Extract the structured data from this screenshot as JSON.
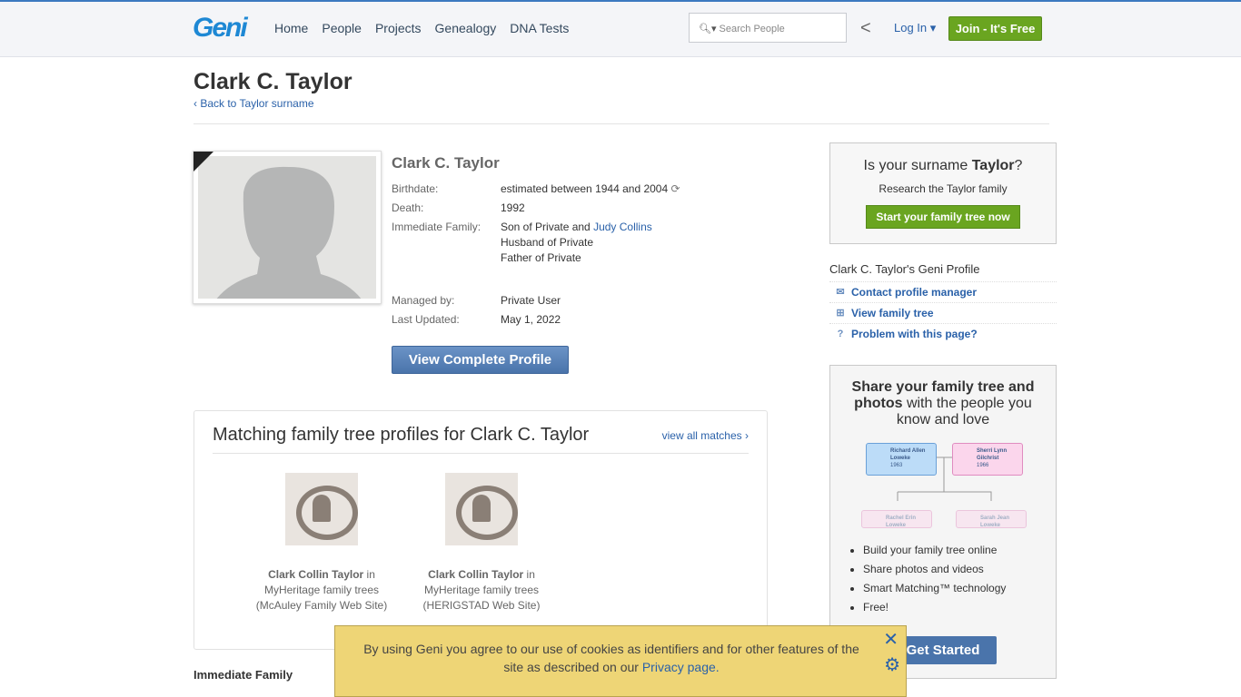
{
  "header": {
    "logo": "Geni",
    "nav": [
      "Home",
      "People",
      "Projects",
      "Genealogy",
      "DNA Tests"
    ],
    "search_placeholder": "Search People",
    "login": "Log In ▾",
    "join": "Join - It's Free"
  },
  "page": {
    "title": "Clark C. Taylor",
    "back": "‹ Back to Taylor surname"
  },
  "profile": {
    "name": "Clark C. Taylor",
    "birthdate_label": "Birthdate:",
    "birthdate": "estimated between 1944 and 2004",
    "death_label": "Death:",
    "death": "1992",
    "family_label": "Immediate Family:",
    "family_son": "Son of Private and ",
    "family_mother": "Judy Collins",
    "family_husband": "Husband of Private",
    "family_father": "Father of Private",
    "managed_label": "Managed by:",
    "managed": "Private User",
    "updated_label": "Last Updated:",
    "updated": "May 1, 2022",
    "view_button": "View Complete Profile"
  },
  "matches": {
    "title": "Matching family tree profiles for Clark C. Taylor",
    "view_all": "view all matches ›",
    "items": [
      {
        "name": "Clark Collin Taylor",
        "in": " in",
        "source": "MyHeritage family trees",
        "site": "(McAuley Family Web Site)"
      },
      {
        "name": "Clark Collin Taylor",
        "in": " in",
        "source": "MyHeritage family trees",
        "site": "(HERIGSTAD Web Site)"
      }
    ]
  },
  "immediate_family": "Immediate Family",
  "sidebar": {
    "surname_q_pre": "Is your surname ",
    "surname": "Taylor",
    "surname_q_post": "?",
    "research": "Research the Taylor family",
    "start_btn": "Start your family tree now",
    "geni_profile": "Clark C. Taylor's Geni Profile",
    "links": [
      "Contact profile manager",
      "View family tree",
      "Problem with this page?"
    ]
  },
  "promo": {
    "bold1": "Share your family tree and photos",
    "rest": " with the people you know and love",
    "tree": [
      {
        "name": "Richard Allen Loweke",
        "year": "1963"
      },
      {
        "name": "Sherri Lynn Gilchrist",
        "year": "1966"
      },
      {
        "name": "Rachel Erin Loweke",
        "year": ""
      },
      {
        "name": "Sarah Jean Loweke",
        "year": ""
      }
    ],
    "bullets": [
      "Build your family tree online",
      "Share photos and videos",
      "Smart Matching™ technology",
      "Free!"
    ],
    "get_started": "Get Started"
  },
  "cookie": {
    "text": "By using Geni you agree to our use of cookies as identifiers and for other features of the site as described on our ",
    "link": "Privacy page."
  }
}
